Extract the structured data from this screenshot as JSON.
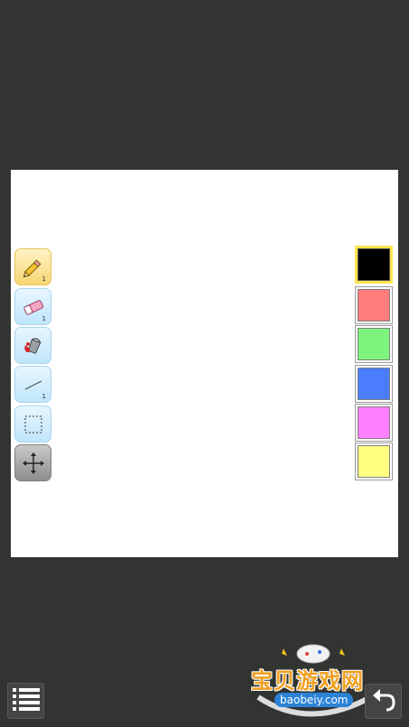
{
  "toolbar": {
    "tools": [
      {
        "name": "pencil",
        "icon": "pencil-icon",
        "sub": "1",
        "active": true
      },
      {
        "name": "eraser",
        "icon": "eraser-icon",
        "sub": "1",
        "active": false
      },
      {
        "name": "fill",
        "icon": "paint-bucket-icon",
        "sub": "",
        "active": false
      },
      {
        "name": "line",
        "icon": "line-icon",
        "sub": "1",
        "active": false
      },
      {
        "name": "select",
        "icon": "selection-icon",
        "sub": "",
        "active": false
      },
      {
        "name": "move",
        "icon": "move-arrows-icon",
        "sub": "",
        "active": false
      }
    ]
  },
  "palette": {
    "selected_index": 0,
    "colors": [
      "#000000",
      "#ff7c7c",
      "#7ef47e",
      "#4a7dff",
      "#ff80ff",
      "#ffff80"
    ]
  },
  "bottom_bar": {
    "menu_icon": "menu-list-icon",
    "undo_icon": "undo-icon"
  },
  "watermark": {
    "title": "宝贝游戏网",
    "site": "baobeiy.com"
  }
}
